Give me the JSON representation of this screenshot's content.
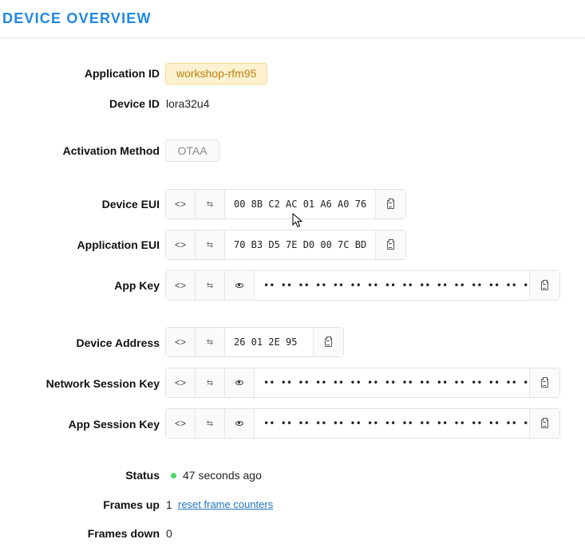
{
  "header": {
    "title": "DEVICE OVERVIEW"
  },
  "fields": {
    "application_id": {
      "label": "Application ID",
      "value": "workshop-rfm95"
    },
    "device_id": {
      "label": "Device ID",
      "value": "lora32u4"
    },
    "activation_method": {
      "label": "Activation Method",
      "value": "OTAA"
    },
    "device_eui": {
      "label": "Device EUI",
      "value": "00 8B C2 AC 01 A6 A0 76"
    },
    "application_eui": {
      "label": "Application EUI",
      "value": "70 B3 D5 7E D0 00 7C BD"
    },
    "app_key": {
      "label": "App Key",
      "value": "•• •• •• •• •• •• •• •• •• •• •• •• •• •• •• ••"
    },
    "device_address": {
      "label": "Device Address",
      "value": "26 01 2E 95"
    },
    "network_session_key": {
      "label": "Network Session Key",
      "value": "•• •• •• •• •• •• •• •• •• •• •• •• •• •• •• ••"
    },
    "app_session_key": {
      "label": "App Session Key",
      "value": "•• •• •• •• •• •• •• •• •• •• •• •• •• •• •• ••"
    },
    "status": {
      "label": "Status",
      "value": "47 seconds ago",
      "color": "#4cd964"
    },
    "frames_up": {
      "label": "Frames up",
      "value": "1",
      "link": "reset frame counters"
    },
    "frames_down": {
      "label": "Frames down",
      "value": "0"
    }
  },
  "icons": {
    "toggle_format": "code-brackets-icon",
    "toggle_byte_order": "swap-icon",
    "reveal": "eye-icon",
    "copy": "clipboard-icon"
  },
  "colors": {
    "accent": "#1e88e5",
    "app_chip_bg": "#fdf2d0",
    "app_chip_text": "#c07f10",
    "link": "#1e73be"
  }
}
